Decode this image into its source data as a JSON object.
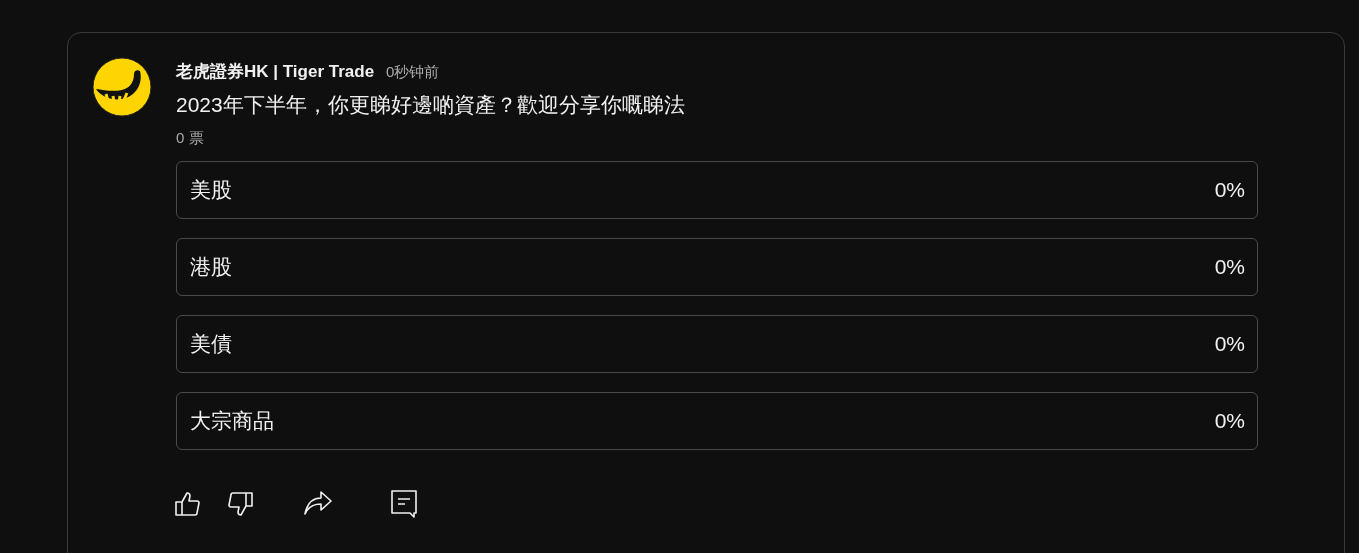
{
  "post": {
    "author": "老虎證券HK | Tiger Trade",
    "time": "0秒钟前",
    "question": "2023年下半年，你更睇好邊啲資產？歡迎分享你嘅睇法",
    "votes": "0 票",
    "options": [
      {
        "label": "美股",
        "percent": "0%"
      },
      {
        "label": "港股",
        "percent": "0%"
      },
      {
        "label": "美債",
        "percent": "0%"
      },
      {
        "label": "大宗商品",
        "percent": "0%"
      }
    ],
    "actions": [
      {
        "kind": "like"
      },
      {
        "kind": "dislike"
      },
      {
        "kind": "share"
      },
      {
        "kind": "comment"
      }
    ]
  }
}
